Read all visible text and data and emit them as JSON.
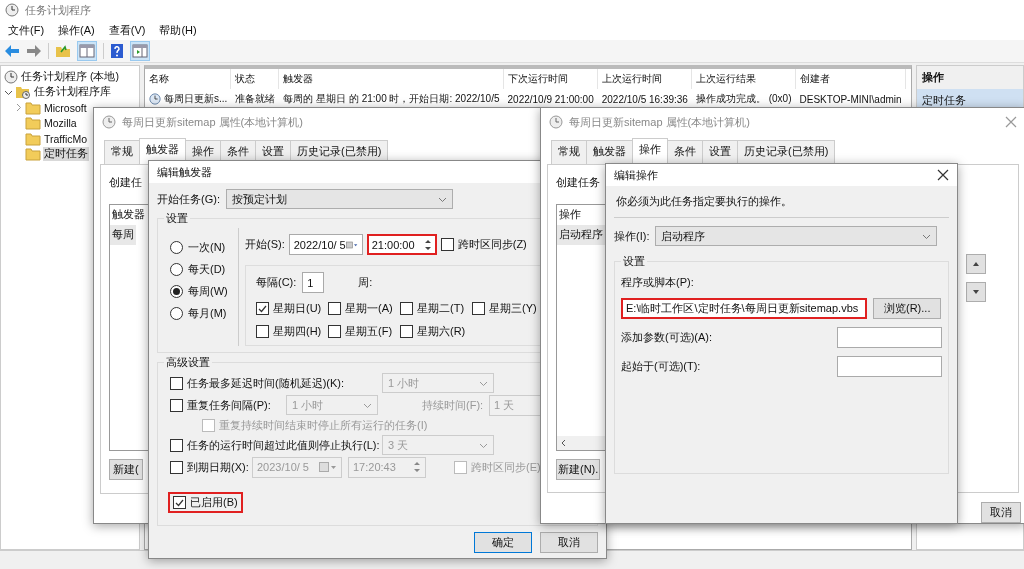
{
  "window": {
    "title": "任务计划程序"
  },
  "menu": [
    {
      "label": "文件(F)"
    },
    {
      "label": "操作(A)"
    },
    {
      "label": "查看(V)"
    },
    {
      "label": "帮助(H)"
    }
  ],
  "tree": [
    {
      "label": "任务计划程序 (本地)",
      "kind": "clock",
      "selected": false,
      "children": [
        {
          "label": "任务计划程序库",
          "kind": "library",
          "selected": false,
          "expanded": true,
          "children": [
            {
              "label": "Microsoft",
              "kind": "folder",
              "selected": false,
              "expanded": false
            },
            {
              "label": "Mozilla",
              "kind": "folder",
              "selected": false
            },
            {
              "label": "TrafficMo",
              "kind": "folder",
              "selected": false
            },
            {
              "label": "定时任务",
              "kind": "folder",
              "selected": true
            }
          ]
        }
      ]
    }
  ],
  "task_table": {
    "columns": [
      "名称",
      "状态",
      "触发器",
      "下次运行时间",
      "上次运行时间",
      "上次运行结果",
      "创建者"
    ],
    "rows": [
      {
        "cells": [
          "每周日更新s...",
          "准备就绪",
          "每周的 星期日 的 21:00 时，开始日期: 2022/10/5",
          "2022/10/9 21:00:00",
          "2022/10/5 16:39:36",
          "操作成功完成。 (0x0)",
          "DESKTOP-MINI\\admin"
        ]
      }
    ]
  },
  "actions_pane": {
    "title": "操作",
    "items": [
      {
        "label": "定时任务",
        "selected": true
      }
    ]
  },
  "trigger_props": {
    "title": "每周日更新sitemap 属性(本地计算机)",
    "tabs": [
      {
        "label": "常规",
        "selected": false
      },
      {
        "label": "触发器",
        "selected": true
      },
      {
        "label": "操作",
        "selected": false
      },
      {
        "label": "条件",
        "selected": false
      },
      {
        "label": "设置",
        "selected": false
      },
      {
        "label": "历史记录(已禁用)",
        "selected": false
      }
    ],
    "intro": "创建任",
    "list_header": "触发器",
    "list_rows": [
      "每周"
    ],
    "new_button": "新建("
  },
  "action_props": {
    "title": "每周日更新sitemap 属性(本地计算机)",
    "tabs": [
      {
        "label": "常规",
        "selected": false
      },
      {
        "label": "触发器",
        "selected": false
      },
      {
        "label": "操作",
        "selected": true
      },
      {
        "label": "条件",
        "selected": false
      },
      {
        "label": "设置",
        "selected": false
      },
      {
        "label": "历史记录(已禁用)",
        "selected": false
      }
    ],
    "intro": "创建任务",
    "list_header": "操作",
    "list_rows": [
      "启动程序"
    ],
    "new_button": "新建(N).",
    "cancel_button": "取消"
  },
  "edit_trigger": {
    "title": "编辑触发器",
    "begin_label": "开始任务(G):",
    "begin_value": "按预定计划",
    "settings_title": "设置",
    "schedule": [
      {
        "label": "一次(N)",
        "selected": false
      },
      {
        "label": "每天(D)",
        "selected": false
      },
      {
        "label": "每周(W)",
        "selected": true
      },
      {
        "label": "每月(M)",
        "selected": false
      }
    ],
    "start_label": "开始(S):",
    "start_date": "2022/10/ 5",
    "start_time": {
      "value": "21:00:00",
      "highlighted": true
    },
    "sync_timezone": {
      "label": "跨时区同步(Z)",
      "checked": false
    },
    "recur_label": "每隔(C):",
    "recur_value": "1",
    "recur_unit": "周:",
    "days": [
      {
        "label": "星期日(U)",
        "checked": true
      },
      {
        "label": "星期一(A)",
        "checked": false
      },
      {
        "label": "星期二(T)",
        "checked": false
      },
      {
        "label": "星期三(Y)",
        "checked": false
      },
      {
        "label": "星期四(H)",
        "checked": false
      },
      {
        "label": "星期五(F)",
        "checked": false
      },
      {
        "label": "星期六(R)",
        "checked": false
      }
    ],
    "advanced_title": "高级设置",
    "advanced": [
      {
        "kind": "select",
        "label": "任务最多延迟时间(随机延迟)(K):",
        "checked": false,
        "value": "1 小时"
      },
      {
        "kind": "repeat",
        "label": "重复任务间隔(P):",
        "checked": false,
        "value": "1 小时",
        "duration_label": "持续时间(F):",
        "duration_value": "1 天"
      },
      {
        "kind": "sub",
        "label": "重复持续时间结束时停止所有运行的任务(I)",
        "checked": false,
        "disabled": true
      },
      {
        "kind": "select",
        "label": "任务的运行时间超过此值则停止执行(L):",
        "checked": false,
        "value": "3 天"
      },
      {
        "kind": "expiry",
        "label": "到期日期(X):",
        "checked": false,
        "date": "2023/10/ 5",
        "time": "17:20:43",
        "sync_label": "跨时区同步(E)",
        "sync_checked": false
      }
    ],
    "enabled": {
      "label": "已启用(B)",
      "checked": true,
      "highlighted": true
    },
    "ok_button": "确定",
    "cancel_button": "取消"
  },
  "edit_action": {
    "title": "编辑操作",
    "instruction": "你必须为此任务指定要执行的操作。",
    "action_label": "操作(I):",
    "action_value": "启动程序",
    "settings_title": "设置",
    "program_label": "程序或脚本(P):",
    "program": {
      "value": "E:\\临时工作区\\定时任务\\每周日更新sitemap.vbs",
      "highlighted": true
    },
    "browse_button": "浏览(R)...",
    "args_label": "添加参数(可选)(A):",
    "start_in_label": "起始于(可选)(T):"
  }
}
